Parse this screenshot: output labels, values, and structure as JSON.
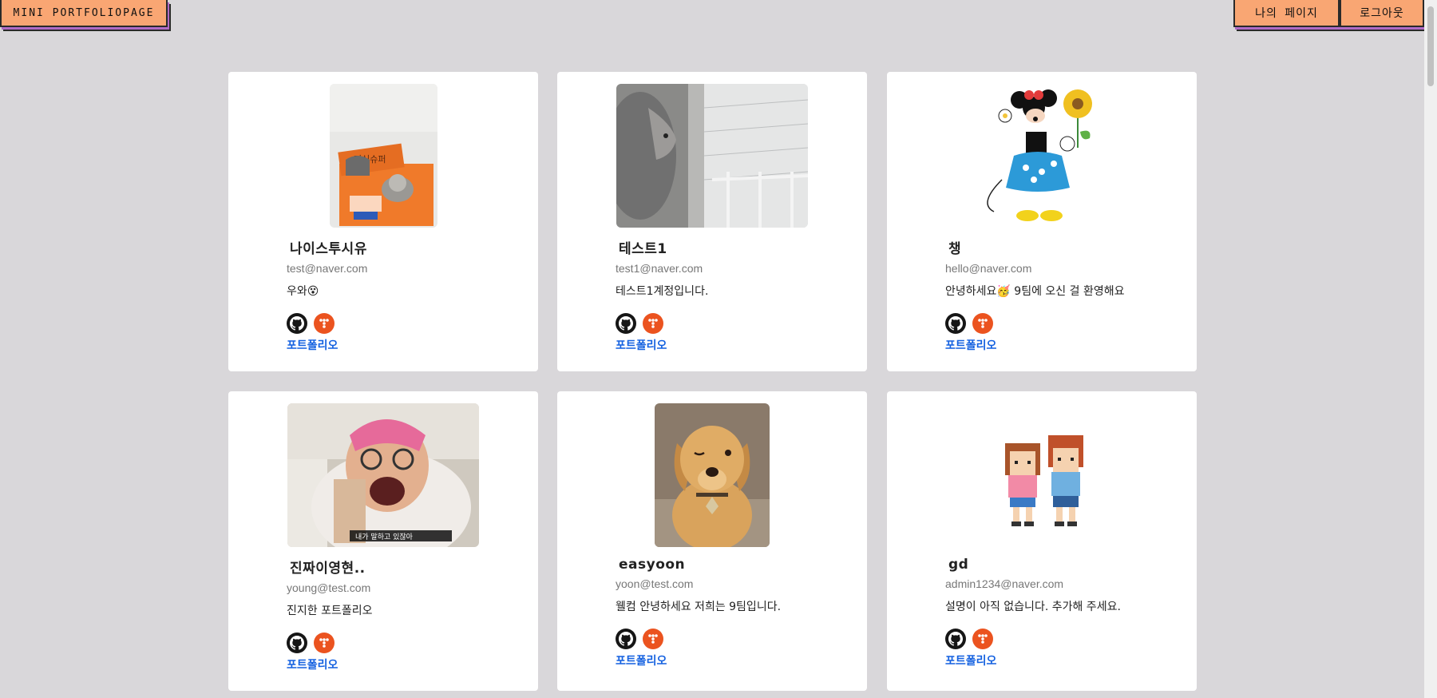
{
  "header": {
    "logo": "MINI PORTFOLIOPAGE",
    "my_page": "나의 페이지",
    "logout": "로그아웃"
  },
  "cards": [
    {
      "name": "나이스투시유",
      "email": "test@naver.com",
      "desc": "우와😵",
      "link": "포트폴리오"
    },
    {
      "name": "테스트1",
      "email": "test1@naver.com",
      "desc": "테스트1계정입니다.",
      "link": "포트폴리오"
    },
    {
      "name": "챙",
      "email": "hello@naver.com",
      "desc": "안녕하세요🥳 9팀에 오신 걸 환영해요",
      "link": "포트폴리오"
    },
    {
      "name": "진짜이영현..",
      "email": "young@test.com",
      "desc": "진지한 포트폴리오",
      "link": "포트폴리오"
    },
    {
      "name": "easyoon",
      "email": "yoon@test.com",
      "desc": "웰컴 안녕하세요 저희는 9팀입니다.",
      "link": "포트폴리오"
    },
    {
      "name": "gd",
      "email": "admin1234@naver.com",
      "desc": "설명이 아직 없습니다. 추가해 주세요.",
      "link": "포트폴리오"
    }
  ],
  "photo_captions": {
    "box_text": "지식슈퍼",
    "subtitle": "내가 말하고 있잖아"
  },
  "icons": {
    "github": "github-icon",
    "tistory": "tistory-icon"
  },
  "colors": {
    "background": "#d9d7da",
    "button": "#f9a673",
    "link": "#1461e0",
    "tistory": "#eb531f"
  }
}
